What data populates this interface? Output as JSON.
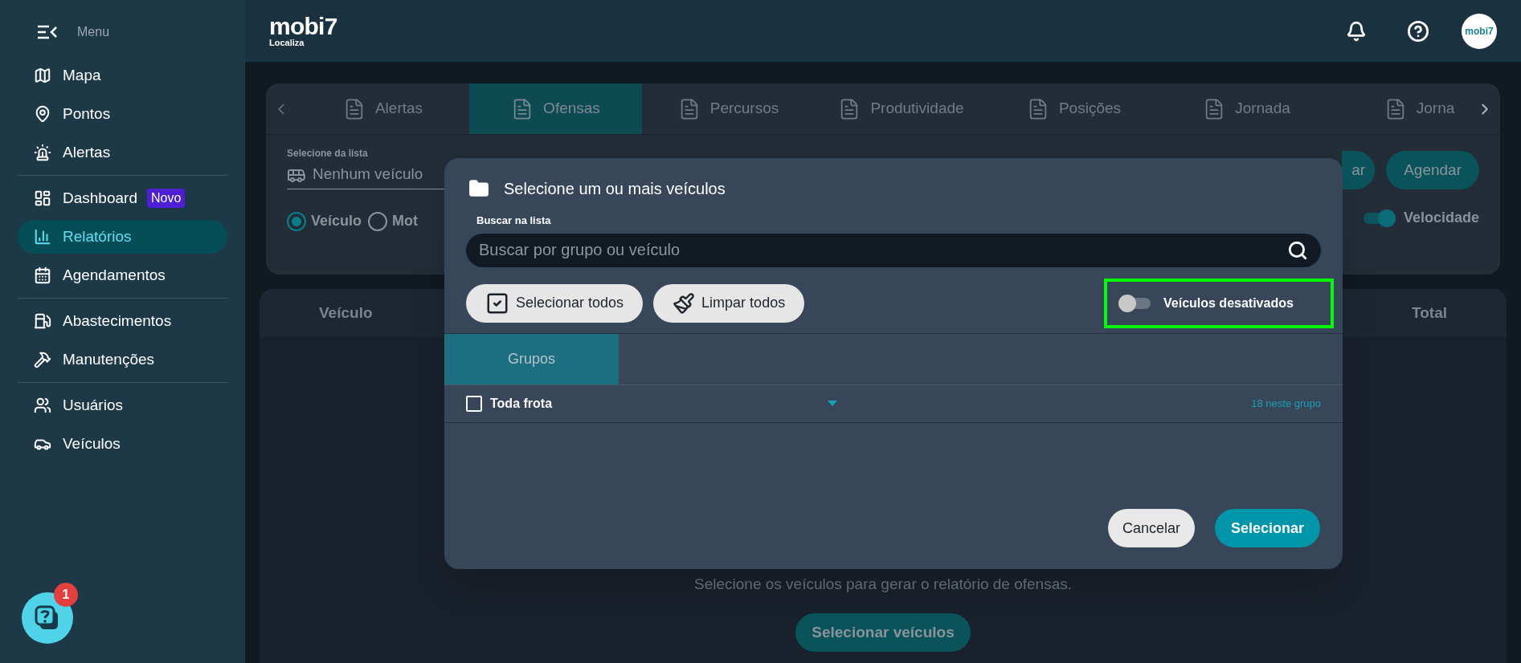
{
  "sidebar": {
    "menu_label": "Menu",
    "groups": [
      [
        {
          "label": "Mapa",
          "selected": false
        },
        {
          "label": "Pontos",
          "selected": false
        },
        {
          "label": "Alertas",
          "selected": false
        }
      ],
      [
        {
          "label": "Dashboard",
          "selected": false,
          "badge": "Novo"
        },
        {
          "label": "Relatórios",
          "selected": true
        },
        {
          "label": "Agendamentos",
          "selected": false
        }
      ],
      [
        {
          "label": "Abastecimentos",
          "selected": false
        },
        {
          "label": "Manutenções",
          "selected": false
        }
      ],
      [
        {
          "label": "Usuários",
          "selected": false
        },
        {
          "label": "Veículos",
          "selected": false
        }
      ]
    ],
    "help_badge": "1"
  },
  "header": {
    "logo": "mobi7",
    "logo_sub": "Localiza",
    "avatar": "mobi7"
  },
  "tabs": [
    {
      "label": "Alertas",
      "selected": false
    },
    {
      "label": "Ofensas",
      "selected": true
    },
    {
      "label": "Percursos",
      "selected": false
    },
    {
      "label": "Produtividade",
      "selected": false
    },
    {
      "label": "Posições",
      "selected": false
    },
    {
      "label": "Jornada",
      "selected": false
    },
    {
      "label": "Jorna",
      "selected": false
    }
  ],
  "filters": {
    "list_label": "Selecione da lista",
    "vehicle_value": "Nenhum veículo",
    "radios": [
      {
        "label": "Veículo",
        "selected": true
      },
      {
        "label": "Mot",
        "selected": false
      }
    ],
    "buttons": [
      "ar",
      "Agendar"
    ],
    "toggle": {
      "label": "Velocidade",
      "on": true
    }
  },
  "table": {
    "columns": [
      "Veículo",
      "Total"
    ],
    "empty_message": "Selecione os veículos para gerar o relatório de ofensas.",
    "action": "Selecionar veículos"
  },
  "modal": {
    "title": "Selecione um ou mais veículos",
    "search_label": "Buscar na lista",
    "search_placeholder": "Buscar por grupo ou veículo",
    "select_all": "Selecionar todos",
    "clear_all": "Limpar todos",
    "toggle": {
      "label": "Veículos desativados",
      "on": false,
      "highlighted": true
    },
    "tabs": [
      {
        "label": "Grupos",
        "selected": true
      }
    ],
    "groups": [
      {
        "name": "Toda frota",
        "checked": false,
        "expanded": false,
        "count": "18 neste grupo"
      }
    ],
    "cancel": "Cancelar",
    "confirm": "Selecionar"
  }
}
